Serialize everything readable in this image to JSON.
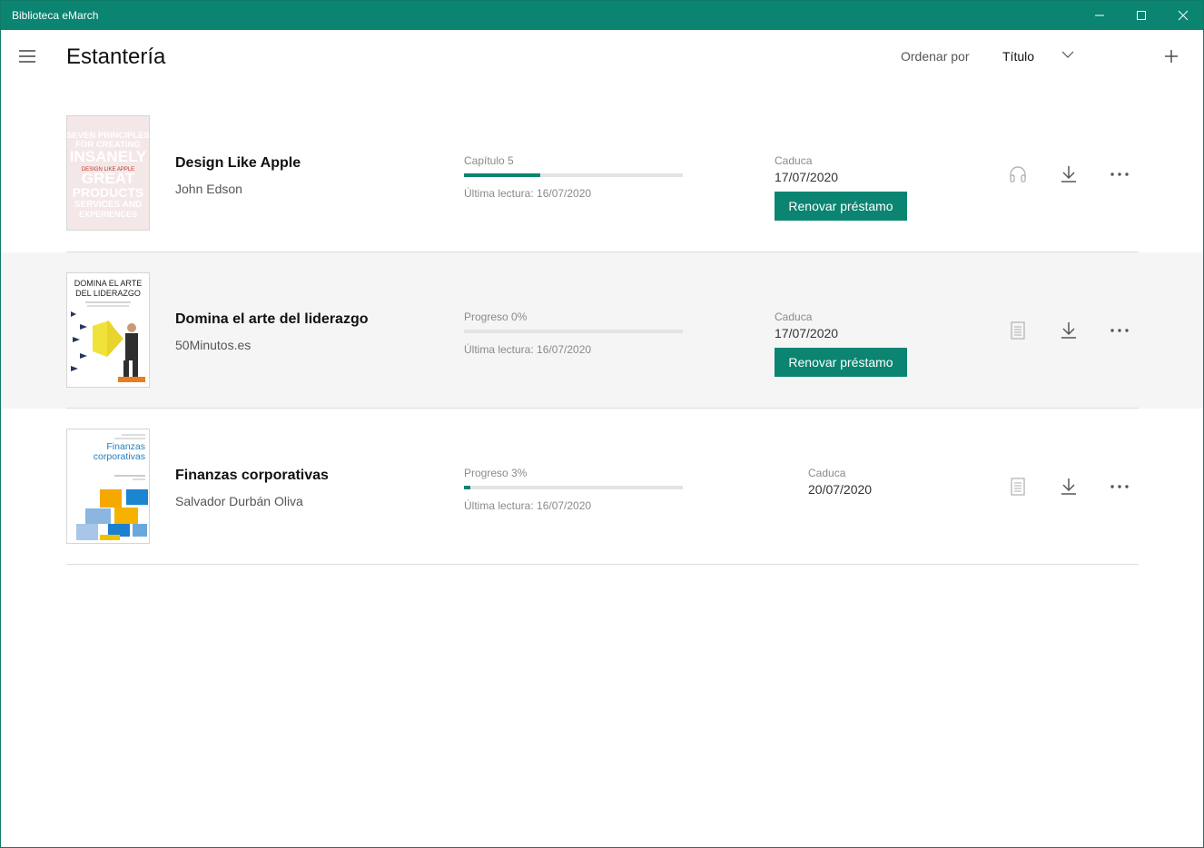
{
  "window": {
    "title": "Biblioteca eMarch",
    "accent": "#0b8471"
  },
  "header": {
    "title": "Estantería",
    "sort_label": "Ordenar por",
    "sort_value": "Título"
  },
  "books": [
    {
      "title": "Design Like Apple",
      "author": "John Edson",
      "progress_label": "Capítulo 5",
      "progress_fraction": 0.35,
      "last_read": "Última lectura:  16/07/2020",
      "due_label": "Caduca",
      "due_date": "17/07/2020",
      "renew_label": "Renovar préstamo",
      "format_icon": "headphones-icon",
      "cover_text": [
        "SEVEN PRINCIPLES",
        "FOR CREATING",
        "INSANELY",
        "DESIGN LIKE APPLE",
        "GREAT",
        "PRODUCTS",
        "SERVICES AND",
        "EXPERIENCES"
      ]
    },
    {
      "title": "Domina el arte del liderazgo",
      "author": "50Minutos.es",
      "progress_label": "Progreso 0%",
      "progress_fraction": 0,
      "last_read": "Última lectura:  16/07/2020",
      "due_label": "Caduca",
      "due_date": "17/07/2020",
      "renew_label": "Renovar préstamo",
      "format_icon": "document-icon",
      "cover_text": [
        "DOMINA EL ARTE",
        "DEL LIDERAZGO"
      ]
    },
    {
      "title": "Finanzas corporativas",
      "author": "Salvador Durbán Oliva",
      "progress_label": "Progreso 3%",
      "progress_fraction": 0.03,
      "last_read": "Última lectura:  16/07/2020",
      "due_label": "Caduca",
      "due_date": "20/07/2020",
      "renew_label": "",
      "format_icon": "document-icon",
      "cover_text": [
        "Finanzas",
        "corporativas"
      ]
    }
  ]
}
